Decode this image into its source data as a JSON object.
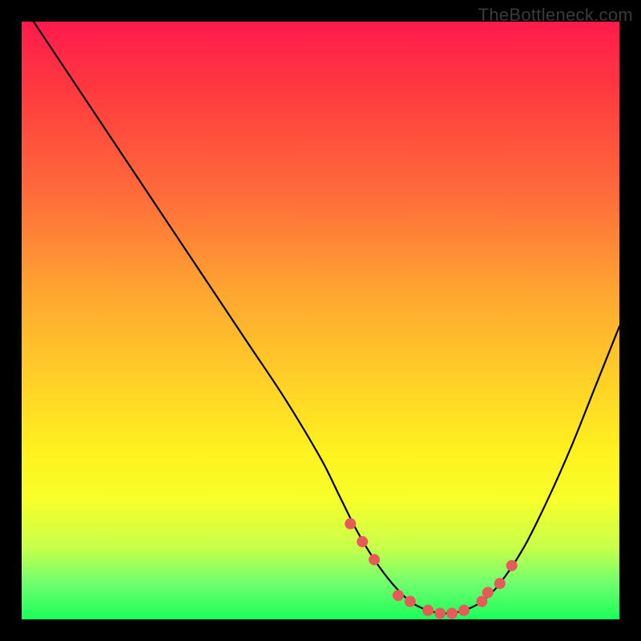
{
  "watermark": {
    "text": "TheBottleneck.com"
  },
  "chart_data": {
    "type": "line",
    "title": "",
    "xlabel": "",
    "ylabel": "",
    "xlim": [
      0,
      100
    ],
    "ylim": [
      0,
      100
    ],
    "series": [
      {
        "name": "curve",
        "x": [
          2,
          8,
          14,
          20,
          26,
          32,
          38,
          44,
          50,
          53,
          56,
          59,
          62,
          65,
          68,
          71,
          74,
          77,
          80,
          84,
          88,
          92,
          96,
          100
        ],
        "y": [
          100,
          91,
          82,
          73,
          64,
          55,
          46,
          37,
          27,
          21,
          15,
          10,
          6,
          3,
          1.5,
          1,
          1.5,
          3,
          6,
          12,
          20,
          29,
          39,
          49
        ]
      }
    ],
    "markers": {
      "name": "dots",
      "color": "#e65a5a",
      "radius_px": 7,
      "x": [
        55,
        57,
        59,
        63,
        65,
        68,
        70,
        72,
        74,
        77,
        78,
        80,
        82
      ],
      "y": [
        16,
        13,
        10,
        4,
        3,
        1.5,
        1,
        1,
        1.5,
        3,
        4.5,
        6,
        9
      ]
    }
  }
}
